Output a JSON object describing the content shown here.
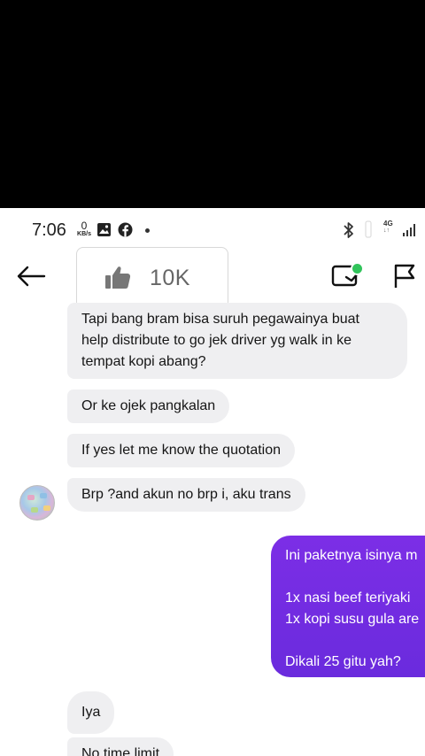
{
  "status_bar": {
    "time": "7:06",
    "net_speed_value": "0",
    "net_speed_unit": "KB/s",
    "network_type": "4G"
  },
  "header": {
    "like_count": "10K"
  },
  "messages": {
    "received": [
      {
        "text": "Tapi bang bram bisa suruh pegawainya buat\nhelp distribute to go jek driver yg walk in ke\ntempat kopi abang?"
      },
      {
        "text": "Or ke ojek pangkalan"
      },
      {
        "text": "If yes let me know the quotation"
      },
      {
        "text": "Brp ?and akun no brp i, aku trans"
      }
    ],
    "sent": [
      {
        "text": "Ini paketnya isinya m\n\n1x nasi beef teriyaki\n1x kopi susu gula are\n\nDikali 25 gitu yah?"
      }
    ],
    "received_after": [
      {
        "text": "Iya"
      },
      {
        "text": "No time limit"
      }
    ]
  },
  "colors": {
    "sent_bubble": "#7c2ee6",
    "received_bubble": "#efeff1",
    "online_indicator": "#31c45b"
  }
}
